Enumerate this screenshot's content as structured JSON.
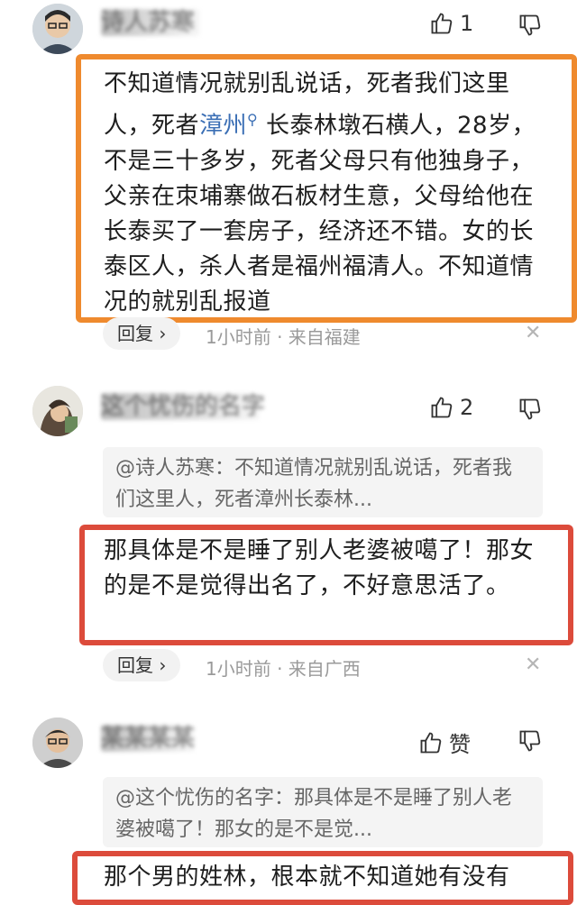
{
  "comments": [
    {
      "username": "诗人苏寒",
      "likes": "1",
      "text_pre": "不知道情况就别乱说话，死者我们这里人，死者",
      "text_link": "漳州",
      "text_post": " 长泰林墩石横人，28岁，不是三十多岁，死者父母只有他独身子，父亲在朿埔寨做石板材生意，父母给他在长泰买了一套房子，经济还不错。女的长泰区人，杀人者是福州福清人。不知道情况的就别乱报道",
      "reply_label": "回复 ›",
      "meta": "1小时前 · 来自福建",
      "close": "✕"
    },
    {
      "username": "这个忧伤的名字",
      "likes": "2",
      "quote": "@诗人苏寒：不知道情况就别乱说话，死者我们这里人，死者漳州长泰林...",
      "text": "那具体是不是睡了别人老婆被噶了！那女的是不是觉得出名了，不好意思活了。",
      "reply_label": "回复 ›",
      "meta": "1小时前 · 来自广西",
      "close": "✕"
    },
    {
      "username": "某某某某",
      "likes": "赞",
      "quote": "@这个忧伤的名字：那具体是不是睡了别人老婆被噶了！那女的是不是觉...",
      "text": "那个男的姓林，根本就不知道她有没有"
    }
  ]
}
